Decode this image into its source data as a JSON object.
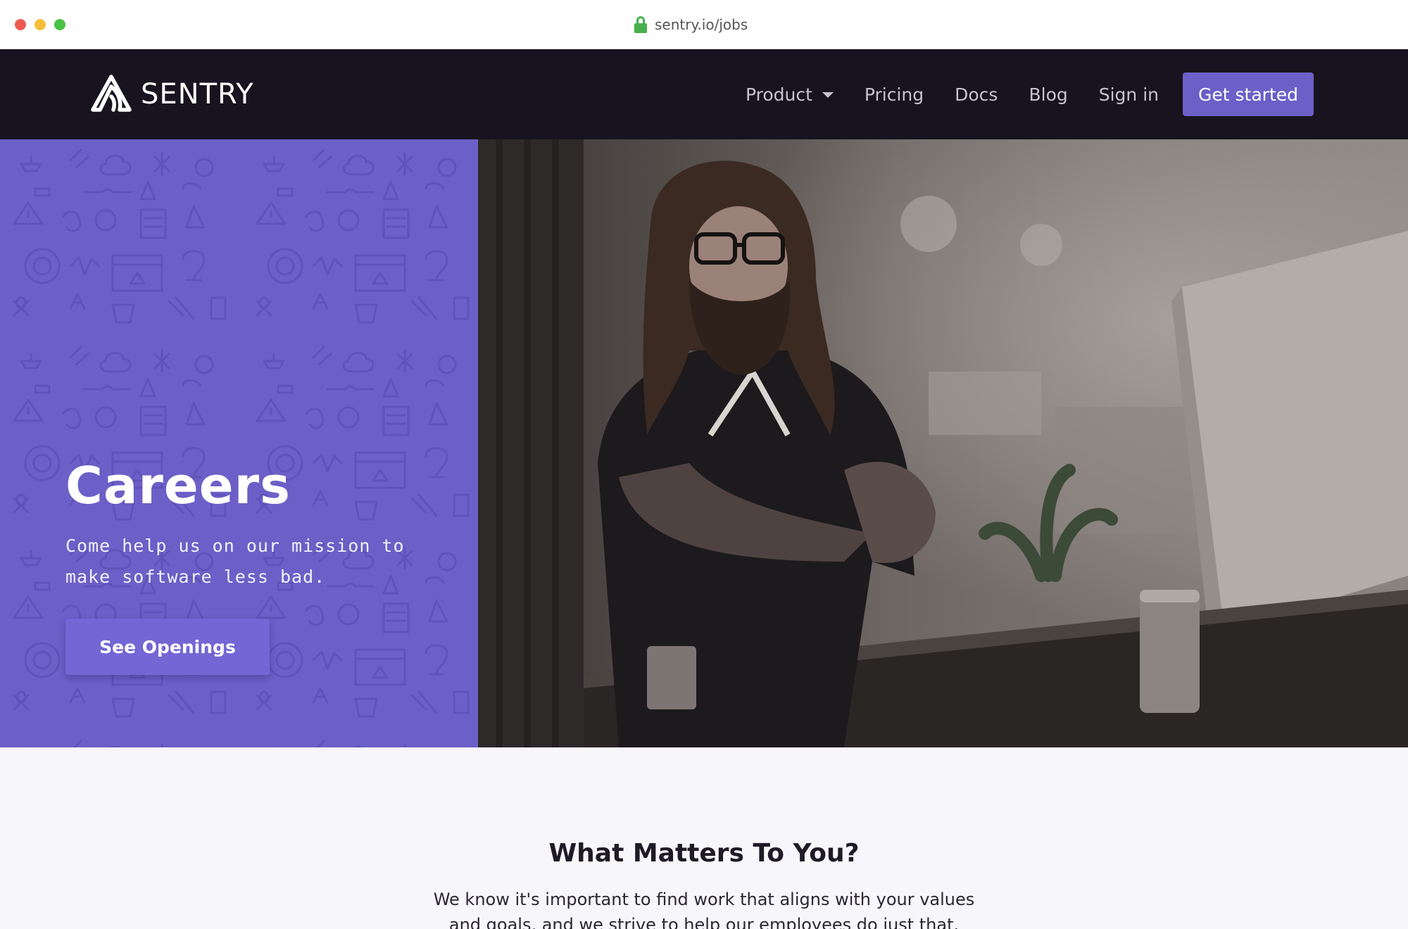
{
  "browser": {
    "url": "sentry.io/jobs"
  },
  "nav": {
    "logo_text": "SENTRY",
    "links": [
      {
        "label": "Product"
      },
      {
        "label": "Pricing"
      },
      {
        "label": "Docs"
      },
      {
        "label": "Blog"
      },
      {
        "label": "Sign in"
      }
    ],
    "cta_label": "Get started"
  },
  "hero": {
    "title": "Careers",
    "subtitle": "Come help us on our mission to make software less bad.",
    "button_label": "See Openings"
  },
  "section": {
    "title": "What Matters To You?",
    "text": "We know it's important to find work that aligns with your values and goals, and we strive to help our employees do just that."
  },
  "colors": {
    "accent": "#6c5fc7",
    "nav_bg": "#17141f",
    "page_bg": "#f7f6fb"
  }
}
